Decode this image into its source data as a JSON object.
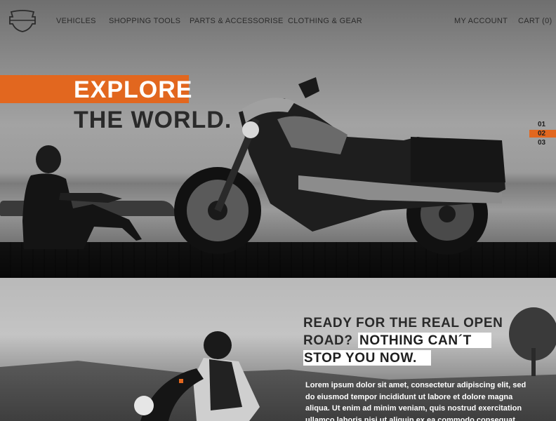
{
  "nav": {
    "links": [
      "VEHICLES",
      "SHOPPING TOOLS",
      "PARTS & ACCESSORISE",
      "CLOTHING & GEAR"
    ],
    "account": "MY ACCOUNT",
    "cart": "CART (0)"
  },
  "hero": {
    "headline_line1": "EXPLORE",
    "headline_line2": "THE WORLD.",
    "slides": [
      "01",
      "02",
      "03"
    ],
    "active_slide": "02"
  },
  "section2": {
    "title_line1": "READY FOR THE REAL OPEN",
    "title_line2a": "ROAD?",
    "title_line2b": "NOTHING CAN´T",
    "title_line3": "STOP YOU NOW.",
    "body": "Lorem ipsum dolor sit amet, consectetur adipiscing elit, sed do eiusmod tempor incididunt ut labore et dolore magna aliqua. Ut enim ad minim veniam, quis nostrud exercitation ullamco laboris nisi ut aliquip ex ea commodo consequat"
  },
  "colors": {
    "accent": "#e2671f",
    "text_dark": "#2a2a2a"
  },
  "icons": {
    "logo": "bar-and-shield-logo-icon",
    "account_chevron": "chevron-down-icon"
  }
}
